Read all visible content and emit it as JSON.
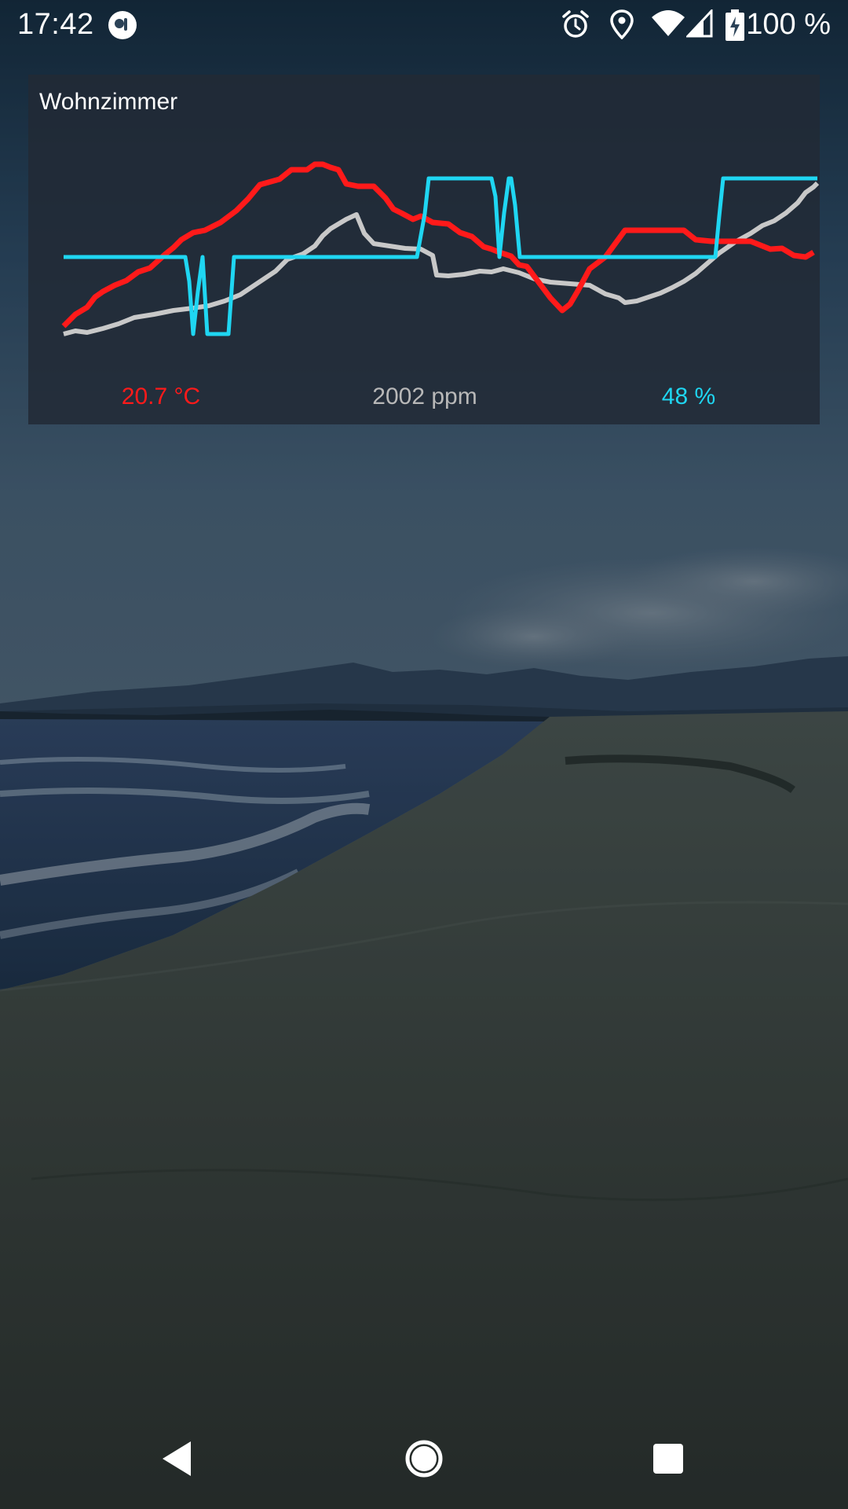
{
  "status_bar": {
    "time": "17:42",
    "battery_text": "100 %",
    "icons": [
      "app-notification-icon",
      "alarm-icon",
      "location-icon",
      "wifi-icon",
      "cell-signal-icon",
      "battery-charging-icon"
    ]
  },
  "widget": {
    "title": "Wohnzimmer",
    "readings": {
      "temperature": "20.7 °C",
      "co2": "2002 ppm",
      "humidity": "48 %"
    },
    "colors": {
      "temperature": "#ff1a1a",
      "co2": "#c8c8c8",
      "humidity": "#1fd6f2"
    }
  },
  "nav_bar": {
    "buttons": [
      "back-icon",
      "home-icon",
      "recents-icon"
    ]
  }
}
